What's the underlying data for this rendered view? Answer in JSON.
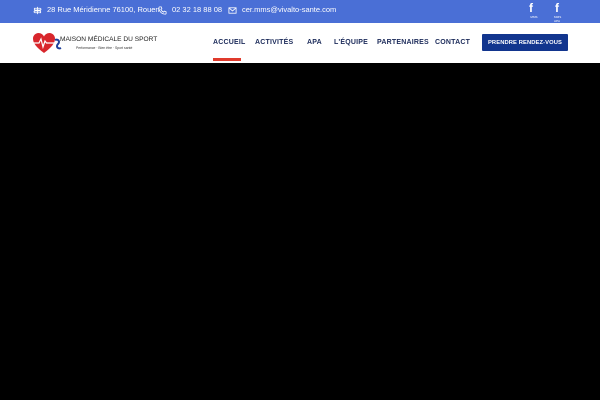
{
  "topbar": {
    "address": "28 Rue Méridienne 76100, Rouen",
    "phone": "02 32 18 88 08",
    "email": "cer.mms@vivalto-sante.com",
    "social": [
      {
        "icon": "facebook-icon",
        "label": "MMS"
      },
      {
        "icon": "facebook-icon",
        "label": "MMS APA"
      }
    ]
  },
  "logo": {
    "title": "MAISON MÉDICALE DU SPORT",
    "subtitle": "Performance · Bien être · Sport santé"
  },
  "nav": {
    "items": [
      "ACCUEIL",
      "ACTIVITÉS",
      "APA",
      "L'ÉQUIPE",
      "PARTENAIRES",
      "CONTACT"
    ],
    "active": "ACCUEIL",
    "cta": "PRENDRE RENDEZ-VOUS"
  },
  "colors": {
    "topbar": "#4a6fd6",
    "nav_text": "#1c2b5a",
    "active_underline": "#e03a2c",
    "cta_bg": "#12358e",
    "hero_bg": "#000000"
  }
}
